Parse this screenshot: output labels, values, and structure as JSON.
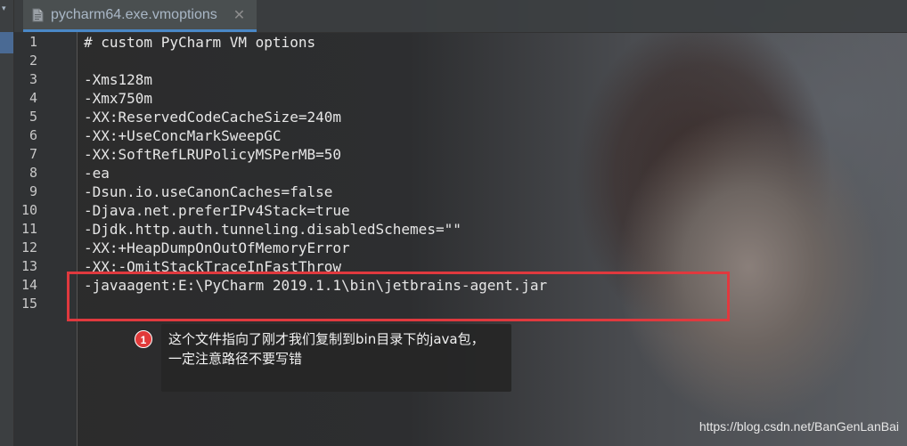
{
  "tab": {
    "filename": "pycharm64.exe.vmoptions",
    "close_glyph": "✕",
    "icon": "file-icon"
  },
  "collapse_arrow": "▾",
  "lines": [
    {
      "num": "1",
      "text": "# custom PyCharm VM options"
    },
    {
      "num": "2",
      "text": ""
    },
    {
      "num": "3",
      "text": "-Xms128m"
    },
    {
      "num": "4",
      "text": "-Xmx750m"
    },
    {
      "num": "5",
      "text": "-XX:ReservedCodeCacheSize=240m"
    },
    {
      "num": "6",
      "text": "-XX:+UseConcMarkSweepGC"
    },
    {
      "num": "7",
      "text": "-XX:SoftRefLRUPolicyMSPerMB=50"
    },
    {
      "num": "8",
      "text": "-ea"
    },
    {
      "num": "9",
      "text": "-Dsun.io.useCanonCaches=false"
    },
    {
      "num": "10",
      "text": "-Djava.net.preferIPv4Stack=true"
    },
    {
      "num": "11",
      "text": "-Djdk.http.auth.tunneling.disabledSchemes=\"\""
    },
    {
      "num": "12",
      "text": "-XX:+HeapDumpOnOutOfMemoryError"
    },
    {
      "num": "13",
      "text": "-XX:-OmitStackTraceInFastThrow"
    },
    {
      "num": "14",
      "text": "-javaagent:E:\\PyCharm 2019.1.1\\bin\\jetbrains-agent.jar"
    },
    {
      "num": "15",
      "text": ""
    }
  ],
  "annotation": {
    "badge": "1",
    "line1": "这个文件指向了刚才我们复制到bin目录下的java包，",
    "line2": "一定注意路径不要写错"
  },
  "watermark": "https://blog.csdn.net/BanGenLanBai",
  "colors": {
    "highlight": "#e0393e",
    "tab_underline": "#4a88c7",
    "badge": "#e23a3a"
  }
}
